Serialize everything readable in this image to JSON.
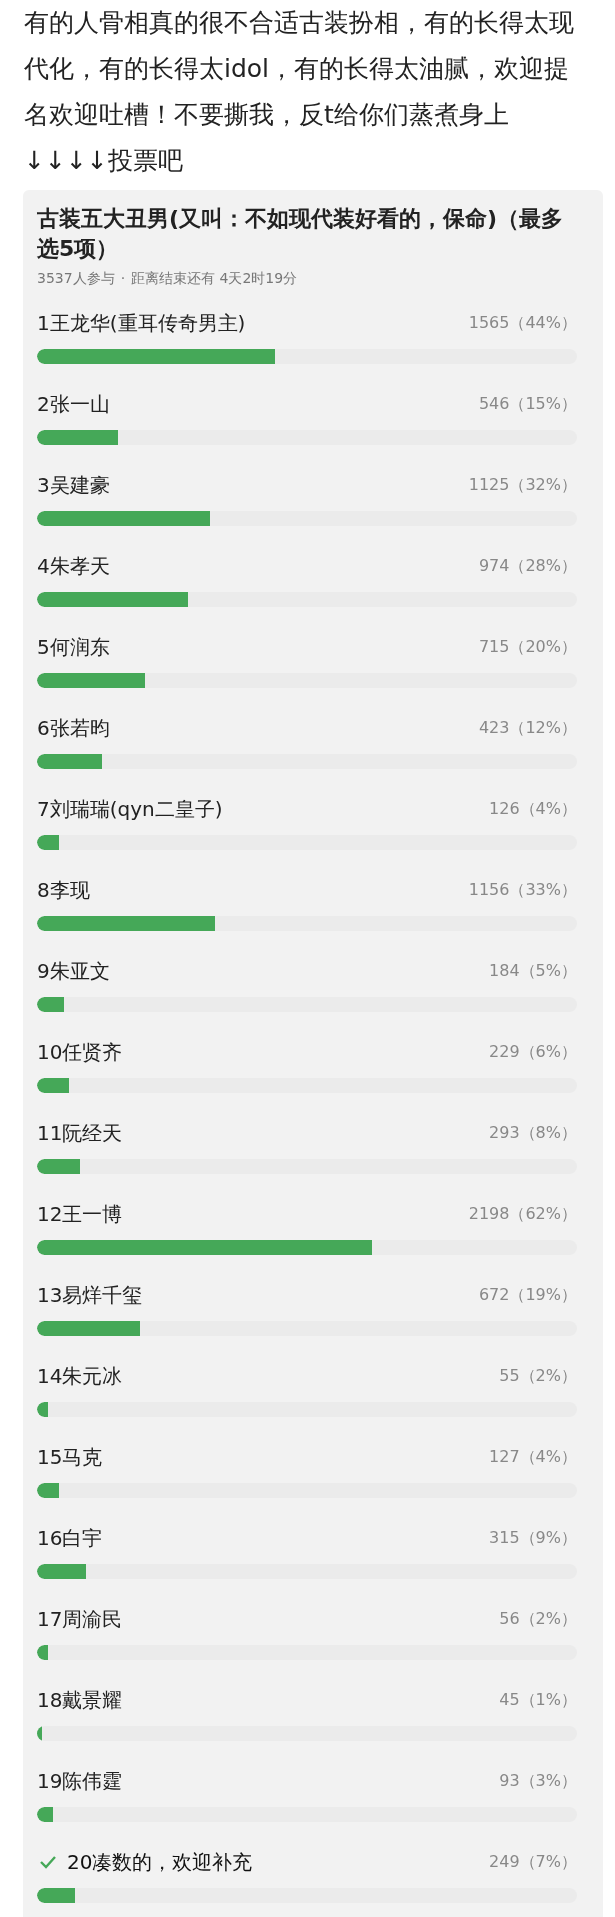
{
  "post": {
    "text": "有的人骨相真的很不合适古装扮相，有的长得太现代化，有的长得太idol，有的长得太油腻，欢迎提名欢迎吐槽！不要撕我，反t给你们蒸煮身上",
    "footer": "↓↓↓↓投票吧"
  },
  "poll": {
    "title": "古装五大丑男(又叫：不如现代装好看的，保命)（最多选5项）",
    "participants": "3537人参与",
    "separator": "·",
    "deadline": "距离结束还有 4天2时19分",
    "options": [
      {
        "label": "1王龙华(重耳传奇男主)",
        "count": "1565（44%）",
        "level": 0.44,
        "selected": false
      },
      {
        "label": "2张一山",
        "count": "546（15%）",
        "level": 0.15,
        "selected": false
      },
      {
        "label": "3吴建豪",
        "count": "1125（32%）",
        "level": 0.32,
        "selected": false
      },
      {
        "label": "4朱孝天",
        "count": "974（28%）",
        "level": 0.28,
        "selected": false
      },
      {
        "label": "5何润东",
        "count": "715（20%）",
        "level": 0.2,
        "selected": false
      },
      {
        "label": "6张若昀",
        "count": "423（12%）",
        "level": 0.12,
        "selected": false
      },
      {
        "label": "7刘瑞瑞(qyn二皇子)",
        "count": "126（4%）",
        "level": 0.04,
        "selected": false
      },
      {
        "label": "8李现",
        "count": "1156（33%）",
        "level": 0.33,
        "selected": false
      },
      {
        "label": "9朱亚文",
        "count": "184（5%）",
        "level": 0.05,
        "selected": false
      },
      {
        "label": "10任贤齐",
        "count": "229（6%）",
        "level": 0.06,
        "selected": false
      },
      {
        "label": "11阮经天",
        "count": "293（8%）",
        "level": 0.08,
        "selected": false
      },
      {
        "label": "12王一博",
        "count": "2198（62%）",
        "level": 0.62,
        "selected": false
      },
      {
        "label": "13易烊千玺",
        "count": "672（19%）",
        "level": 0.19,
        "selected": false
      },
      {
        "label": "14朱元冰",
        "count": "55（2%）",
        "level": 0.02,
        "selected": false
      },
      {
        "label": "15马克",
        "count": "127（4%）",
        "level": 0.04,
        "selected": false
      },
      {
        "label": "16白宇",
        "count": "315（9%）",
        "level": 0.09,
        "selected": false
      },
      {
        "label": "17周渝民",
        "count": "56（2%）",
        "level": 0.02,
        "selected": false
      },
      {
        "label": "18戴景耀",
        "count": "45（1%）",
        "level": 0.01,
        "selected": false
      },
      {
        "label": "19陈伟霆",
        "count": "93（3%）",
        "level": 0.03,
        "selected": false
      },
      {
        "label": "20凑数的，欢迎补充",
        "count": "249（7%）",
        "level": 0.07,
        "selected": true
      }
    ]
  }
}
